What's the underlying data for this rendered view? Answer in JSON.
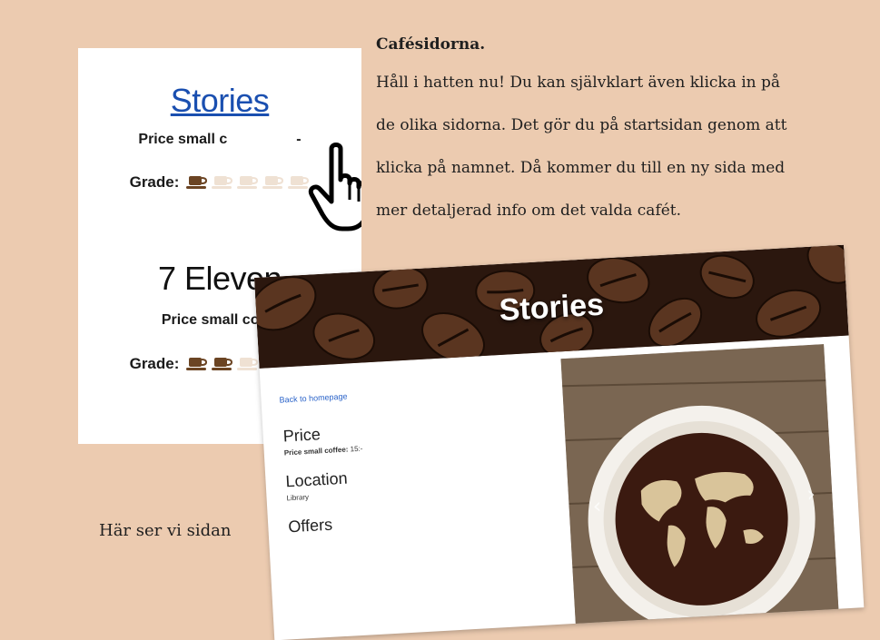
{
  "list_card": {
    "cafe1": {
      "name": "Stories",
      "price_label": "Price small c",
      "price_tail": "-",
      "grade_label": "Grade:",
      "grade_filled": 1,
      "grade_total": 5
    },
    "cafe2": {
      "name": "7 Eleven",
      "price_label": "Price small coff",
      "grade_label": "Grade:",
      "grade_filled": 2,
      "grade_total": 5
    }
  },
  "text": {
    "heading": "Cafésidorna.",
    "lines": [
      "Håll i hatten nu! Du kan självklart även klicka in på",
      "de olika sidorna. Det gör du på startsidan genom att",
      "klicka på namnet. Då kommer du till en ny sida med",
      "mer detaljerad info om det valda cafét."
    ],
    "caption": "Här ser vi sidan"
  },
  "detail": {
    "title": "Stories",
    "back_link": "Back to homepage",
    "price_title": "Price",
    "price_label": "Price small coffee:",
    "price_value": "15:-",
    "location_title": "Location",
    "location_value": "Library",
    "offers_title": "Offers",
    "prev_icon": "‹",
    "next_icon": "›"
  },
  "colors": {
    "background": "#eccbb0",
    "link": "#1a4fb0",
    "cup_filled": "#6b4423",
    "cup_empty": "#efe1d3"
  }
}
